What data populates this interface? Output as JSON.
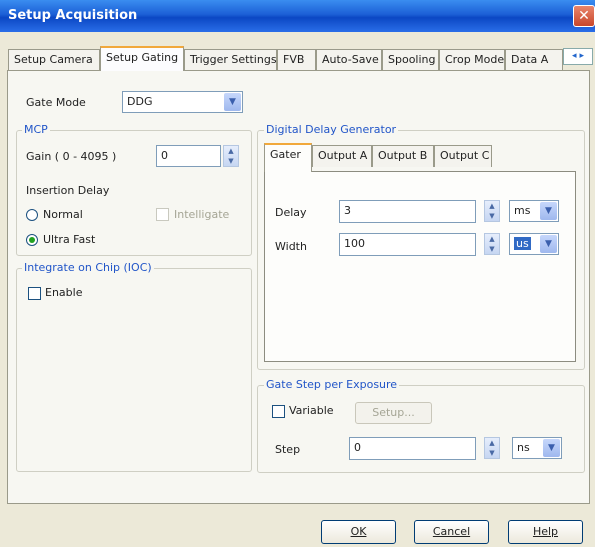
{
  "window": {
    "title": "Setup Acquisition",
    "close_label": "✕"
  },
  "tabs": [
    {
      "label": "Setup Camera",
      "active": false
    },
    {
      "label": "Setup Gating",
      "active": true
    },
    {
      "label": "Trigger Settings",
      "active": false
    },
    {
      "label": "FVB",
      "active": false
    },
    {
      "label": "Auto-Save",
      "active": false
    },
    {
      "label": "Spooling",
      "active": false
    },
    {
      "label": "Crop Mode",
      "active": false
    },
    {
      "label": "Data A",
      "active": false
    }
  ],
  "tab_scroll": {
    "left": "◂",
    "right": "▸"
  },
  "gate_mode": {
    "label": "Gate Mode",
    "value": "DDG"
  },
  "mcp": {
    "title": "MCP",
    "gain_label": "Gain ( 0 - 4095 )",
    "gain_value": "0",
    "insertion_delay_label": "Insertion Delay",
    "normal_label": "Normal",
    "ultra_fast_label": "Ultra Fast",
    "intelligate_label": "Intelligate"
  },
  "ioc": {
    "title": "Integrate on Chip (IOC)",
    "enable_label": "Enable"
  },
  "ddg": {
    "title": "Digital Delay Generator",
    "tabs": [
      "Gater",
      "Output A",
      "Output B",
      "Output C"
    ],
    "delay_label": "Delay",
    "delay_value": "3",
    "delay_unit": "ms",
    "width_label": "Width",
    "width_value": "100",
    "width_unit": "us"
  },
  "gate_step": {
    "title": "Gate Step per Exposure",
    "variable_label": "Variable",
    "setup_label": "Setup...",
    "step_label": "Step",
    "step_value": "0",
    "step_unit": "ns"
  },
  "buttons": {
    "ok": "OK",
    "cancel": "Cancel",
    "help": "Help"
  },
  "spin_glyph": {
    "up": "▲",
    "down": "▼"
  },
  "dropdown_glyph": "▼"
}
